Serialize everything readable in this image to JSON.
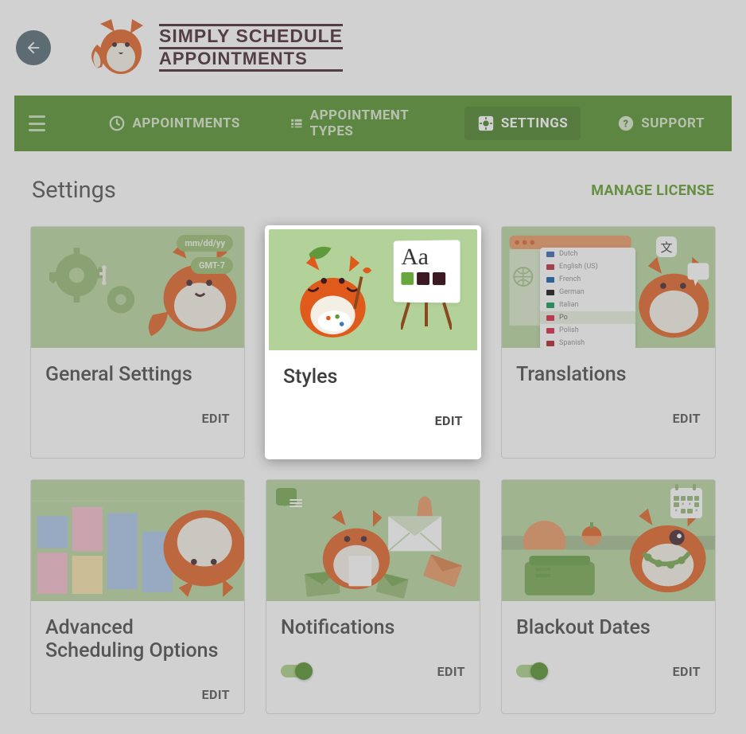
{
  "logo": {
    "line1": "SIMPLY SCHEDULE",
    "line2": "APPOINTMENTS"
  },
  "nav": {
    "appointments": "APPOINTMENTS",
    "types": "APPOINTMENT TYPES",
    "settings": "SETTINGS",
    "support": "SUPPORT"
  },
  "page": {
    "title": "Settings",
    "manage_license": "MANAGE LICENSE"
  },
  "cards": {
    "general": {
      "title": "General Settings",
      "edit": "EDIT",
      "date_fmt": "mm/dd/yy",
      "tz": "GMT-7"
    },
    "styles": {
      "title": "Styles",
      "edit": "EDIT",
      "easel_text": "Aa"
    },
    "translations": {
      "title": "Translations",
      "edit": "EDIT",
      "langs": [
        "Dutch",
        "English (US)",
        "French",
        "German",
        "Italian",
        "Po",
        "Polish",
        "Spanish"
      ],
      "lang_flags": [
        "#2e5aac",
        "#b22234",
        "#0055a4",
        "#000000",
        "#009246",
        "#dc143c",
        "#dc143c",
        "#aa151b"
      ],
      "sel_index": 5,
      "badge": "文"
    },
    "advanced": {
      "title": "Advanced Scheduling Options",
      "edit": "EDIT"
    },
    "notifications": {
      "title": "Notifications",
      "edit": "EDIT"
    },
    "blackout": {
      "title": "Blackout Dates",
      "edit": "EDIT"
    }
  }
}
